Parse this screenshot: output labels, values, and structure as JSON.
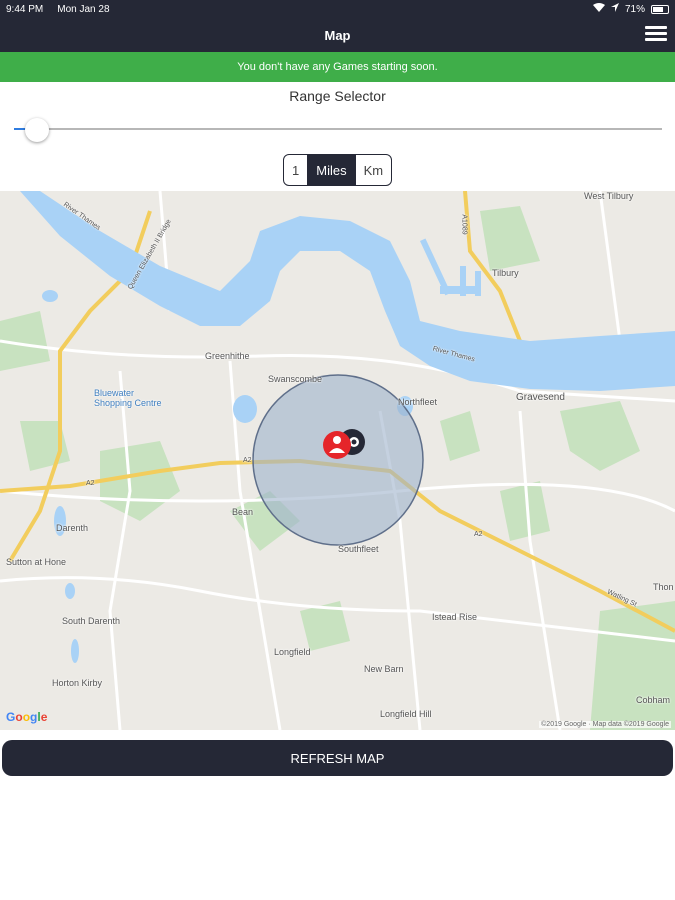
{
  "status_bar": {
    "time": "9:44 PM",
    "date": "Mon Jan 28",
    "battery": "71%",
    "battery_level": 0.71
  },
  "nav": {
    "title": "Map"
  },
  "banner": {
    "text": "You don't have any Games starting soon."
  },
  "range": {
    "title": "Range Selector",
    "value": "1",
    "slider_fraction": 0.035
  },
  "units": {
    "miles": "Miles",
    "km": "Km",
    "selected": "Miles"
  },
  "map": {
    "places": [
      "West Tilbury",
      "Tilbury",
      "River Thames",
      "River Thames",
      "Greenhithe",
      "Swanscombe",
      "Bluewater Shopping Centre",
      "Northfleet",
      "Gravesend",
      "Bean",
      "Darenth",
      "Sutton at Hone",
      "Southfleet",
      "South Darenth",
      "Istead Rise",
      "Longfield",
      "New Barn",
      "Horton Kirby",
      "Longfield Hill",
      "Cobham",
      "Thon",
      "A2",
      "A2",
      "A2",
      "A1089",
      "Watling St",
      "Queen Elizabeth II Bridge"
    ],
    "logo": "Google",
    "attribution": "©2019 Google · Map data ©2019 Google"
  },
  "refresh_button": {
    "label": "REFRESH MAP"
  },
  "colors": {
    "dark": "#252836",
    "green": "#3fae49",
    "river": "#a9d2f6",
    "radius_fill": "#9fb2cc",
    "marker": "#e5252a"
  }
}
